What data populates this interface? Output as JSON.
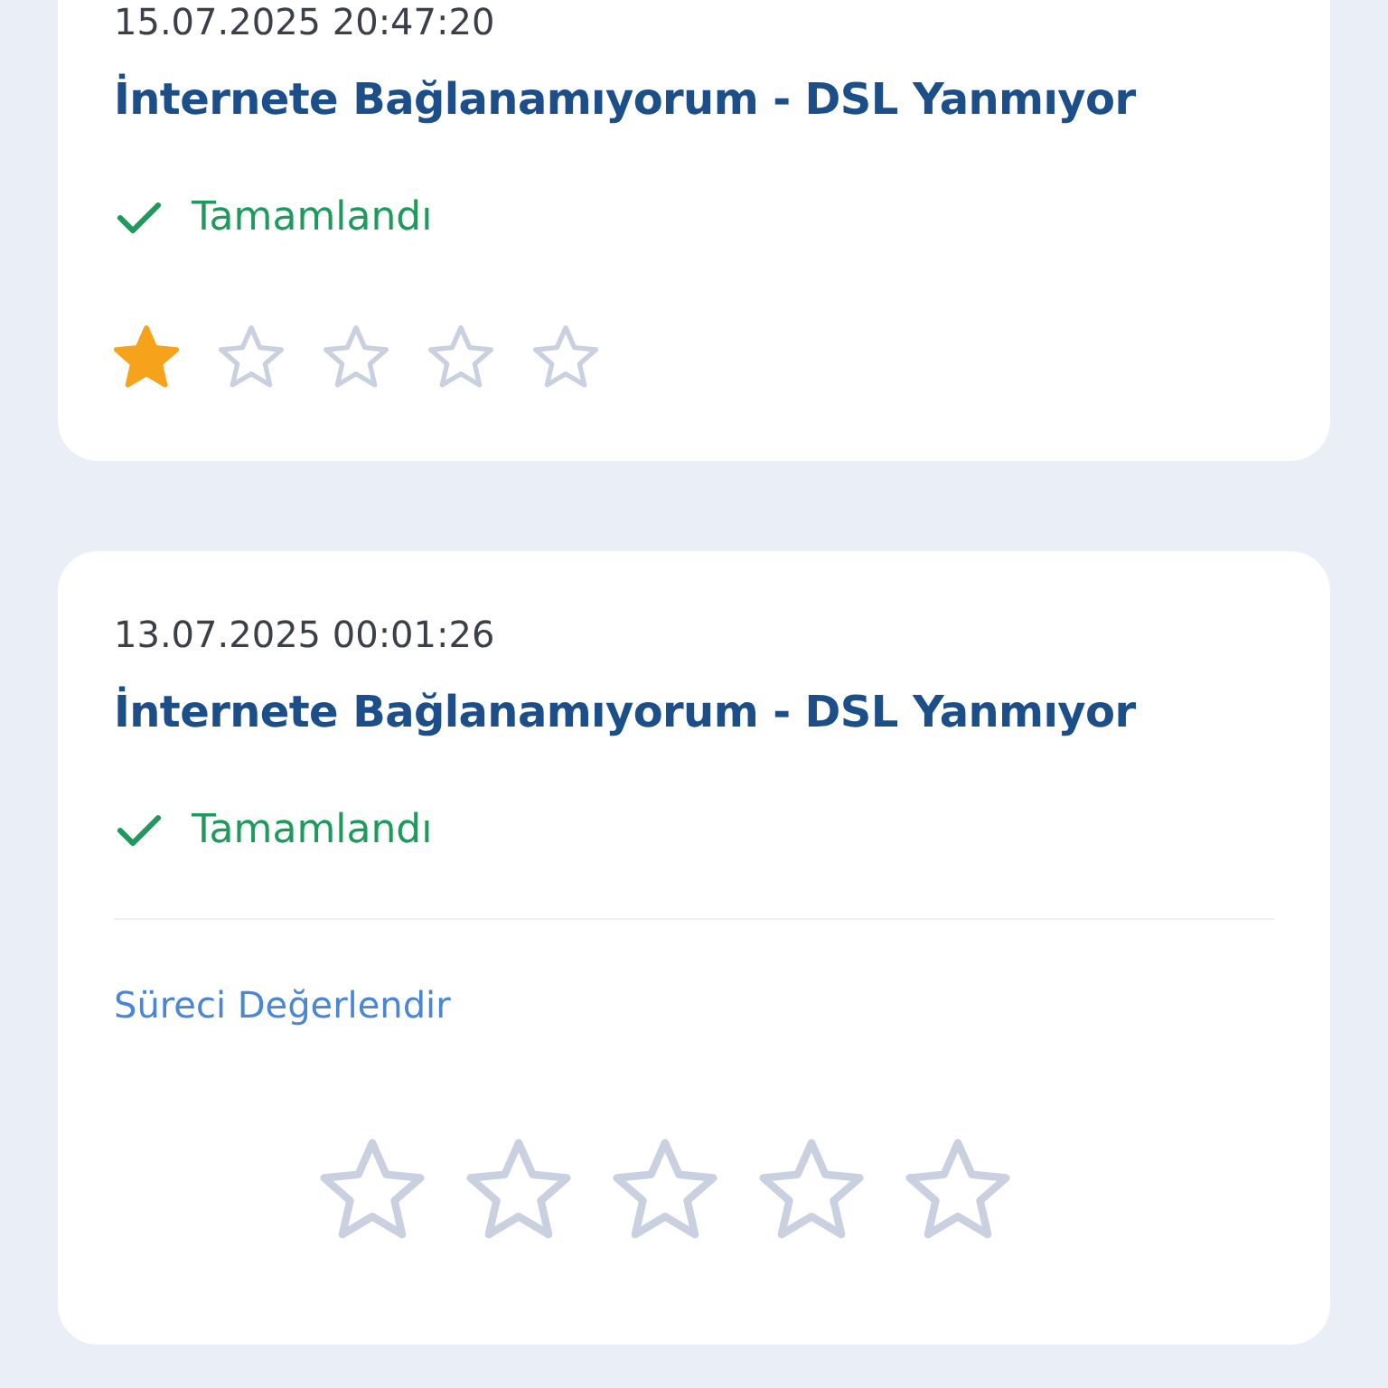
{
  "cards": [
    {
      "kind": "rated",
      "date": "15.07.2025 20:47:20",
      "title": "İnternete Bağlanamıyorum - DSL Yanmıyor",
      "status": {
        "kind": "completed",
        "label": "Tamamlandı"
      },
      "stars": 1
    },
    {
      "kind": "rate",
      "date": "13.07.2025 00:01:26",
      "title": "İnternete Bağlanamıyorum - DSL Yanmıyor",
      "status": {
        "kind": "completed",
        "label": "Tamamlandı"
      },
      "rate_label": "Süreci Değerlendir",
      "stars": 0
    }
  ]
}
